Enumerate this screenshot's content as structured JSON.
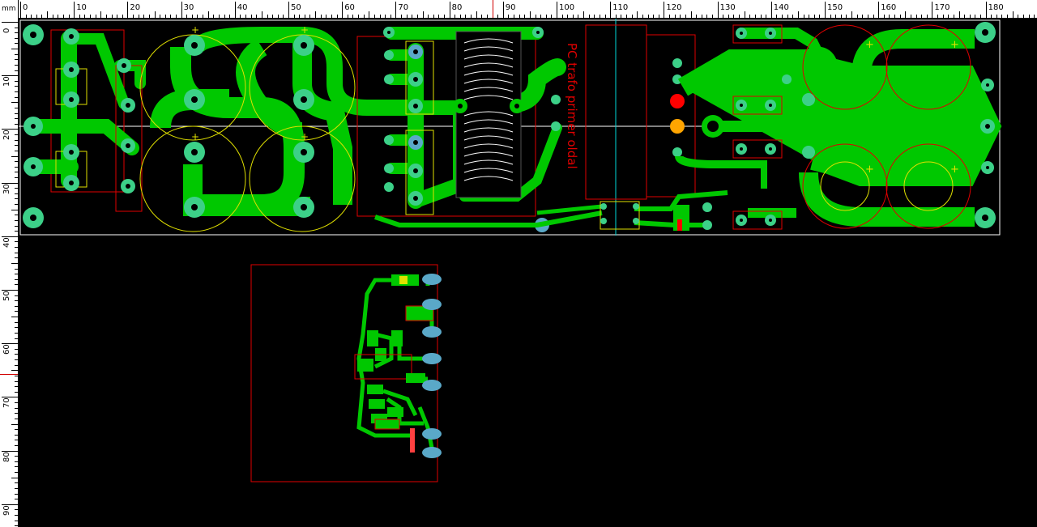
{
  "ruler": {
    "unit": "mm",
    "h_labels": [
      "0",
      "10",
      "20",
      "30",
      "40",
      "50",
      "60",
      "70",
      "80",
      "90",
      "100",
      "110",
      "120",
      "130",
      "140",
      "150",
      "160",
      "170",
      "180"
    ],
    "v_labels": [
      "0",
      "10",
      "20",
      "30",
      "40",
      "50",
      "60",
      "70",
      "80",
      "90"
    ]
  },
  "board": {
    "silk_text": "PC trafo primer oldal",
    "pad_colors": {
      "copper": "#00c800",
      "pad": "#3cd088",
      "pad_blue": "#5aa8c8",
      "outline": "#e00000",
      "silk": "#e0e000",
      "hole": "#000000",
      "marker_red": "#ff0000",
      "marker_orange": "#ffa500"
    }
  }
}
